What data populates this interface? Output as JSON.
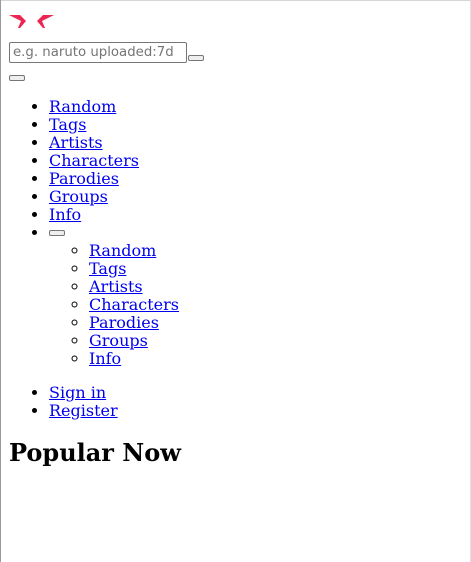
{
  "logo": {
    "icon": "double-chevron-logo-icon",
    "color": "#ed2553"
  },
  "search": {
    "placeholder": "e.g. naruto uploaded:7d",
    "value": ""
  },
  "nav": {
    "items": [
      {
        "label": "Random"
      },
      {
        "label": "Tags"
      },
      {
        "label": "Artists"
      },
      {
        "label": "Characters"
      },
      {
        "label": "Parodies"
      },
      {
        "label": "Groups"
      },
      {
        "label": "Info"
      }
    ],
    "dropdown": {
      "items": [
        {
          "label": "Random"
        },
        {
          "label": "Tags"
        },
        {
          "label": "Artists"
        },
        {
          "label": "Characters"
        },
        {
          "label": "Parodies"
        },
        {
          "label": "Groups"
        },
        {
          "label": "Info"
        }
      ]
    }
  },
  "account": {
    "sign_in": "Sign in",
    "register": "Register"
  },
  "main": {
    "heading": "Popular Now"
  }
}
